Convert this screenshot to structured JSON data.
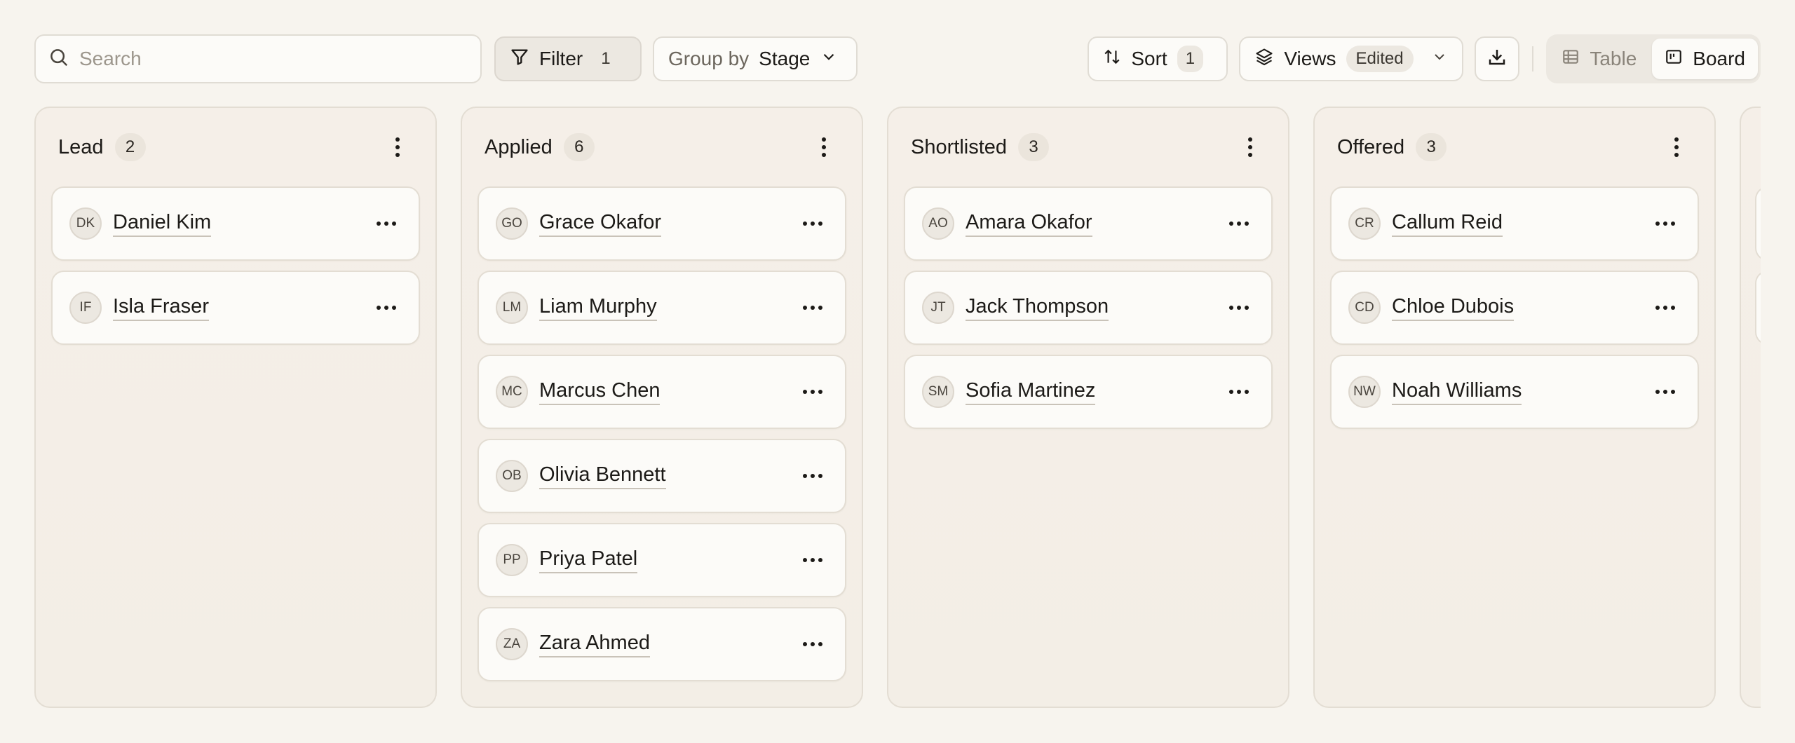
{
  "toolbar": {
    "search_placeholder": "Search",
    "filter_label": "Filter",
    "filter_count": "1",
    "group_by_label": "Group by",
    "group_by_value": "Stage",
    "sort_label": "Sort",
    "sort_count": "1",
    "views_label": "Views",
    "views_status": "Edited",
    "view_table_label": "Table",
    "view_board_label": "Board"
  },
  "columns": [
    {
      "title": "Lead",
      "count": "2",
      "cards": [
        {
          "initials": "DK",
          "name": "Daniel Kim"
        },
        {
          "initials": "IF",
          "name": "Isla Fraser"
        }
      ]
    },
    {
      "title": "Applied",
      "count": "6",
      "cards": [
        {
          "initials": "GO",
          "name": "Grace Okafor"
        },
        {
          "initials": "LM",
          "name": "Liam Murphy"
        },
        {
          "initials": "MC",
          "name": "Marcus Chen"
        },
        {
          "initials": "OB",
          "name": "Olivia Bennett"
        },
        {
          "initials": "PP",
          "name": "Priya Patel"
        },
        {
          "initials": "ZA",
          "name": "Zara Ahmed"
        }
      ]
    },
    {
      "title": "Shortlisted",
      "count": "3",
      "cards": [
        {
          "initials": "AO",
          "name": "Amara Okafor"
        },
        {
          "initials": "JT",
          "name": "Jack Thompson"
        },
        {
          "initials": "SM",
          "name": "Sofia Martinez"
        }
      ]
    },
    {
      "title": "Offered",
      "count": "3",
      "cards": [
        {
          "initials": "CR",
          "name": "Callum Reid"
        },
        {
          "initials": "CD",
          "name": "Chloe Dubois"
        },
        {
          "initials": "NW",
          "name": "Noah Williams"
        }
      ]
    }
  ]
}
